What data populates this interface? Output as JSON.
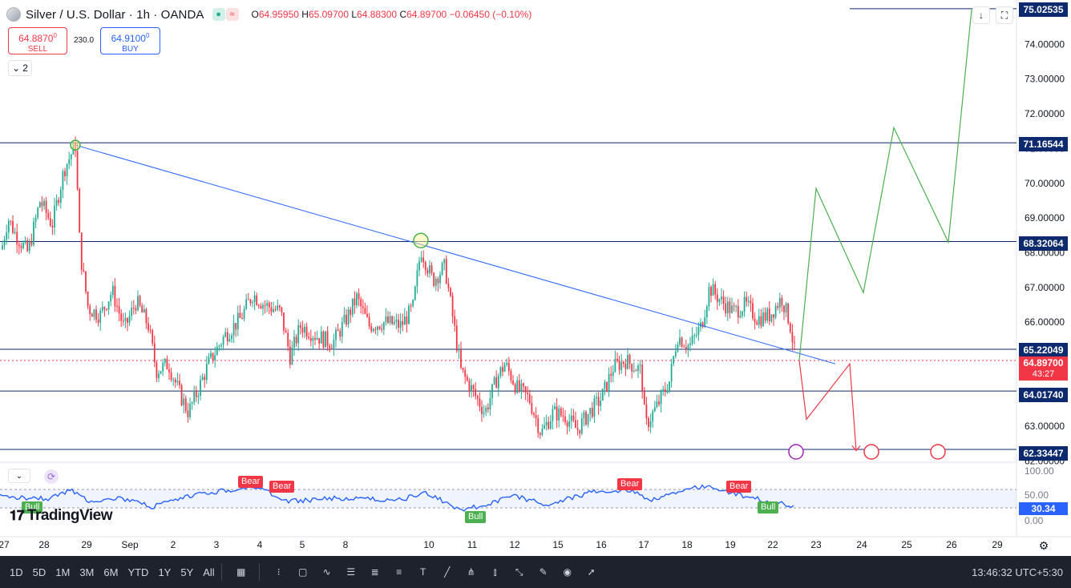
{
  "header": {
    "symbol_title": "Silver / U.S. Dollar · 1h · OANDA",
    "ohlc": {
      "open_label": "O",
      "open": "64.95950",
      "high_label": "H",
      "high": "65.09700",
      "low_label": "L",
      "low": "64.88300",
      "close_label": "C",
      "close": "64.89700",
      "change": "−0.06450 (−0.10%)"
    }
  },
  "trade": {
    "sell_price": "64.8870",
    "sell_price_sup": "0",
    "sell_label": "SELL",
    "spread": "230.0",
    "buy_price": "64.9100",
    "buy_price_sup": "0",
    "buy_label": "BUY"
  },
  "indicators_toggle": {
    "count": "2"
  },
  "price_axis": {
    "ticks": [
      "75.00000",
      "74.00000",
      "73.00000",
      "72.00000",
      "71.00000",
      "70.00000",
      "69.00000",
      "68.00000",
      "67.00000",
      "66.00000",
      "65.00000",
      "64.00000",
      "63.00000",
      "62.00000"
    ],
    "tags": {
      "top": "75.02535",
      "r1": "71.16544",
      "r2": "68.32064",
      "r3": "65.22049",
      "current_price": "64.89700",
      "countdown": "43:27",
      "s1": "64.01740",
      "s2": "62.33447"
    }
  },
  "rsi": {
    "value": "30.34",
    "ticks": [
      "100.00",
      "50.00",
      "0.00"
    ],
    "labels": {
      "bear": "Bear",
      "bull": "Bull",
      "bull_partial": "Bull"
    }
  },
  "time_axis": {
    "ticks": [
      {
        "label": "27"
      },
      {
        "label": "28"
      },
      {
        "label": "29"
      },
      {
        "label": "Sep"
      },
      {
        "label": "2"
      },
      {
        "label": "3"
      },
      {
        "label": "4"
      },
      {
        "label": "5"
      },
      {
        "label": "8"
      },
      {
        "label": "10"
      },
      {
        "label": "11"
      },
      {
        "label": "12"
      },
      {
        "label": "15"
      },
      {
        "label": "16"
      },
      {
        "label": "17"
      },
      {
        "label": "18"
      },
      {
        "label": "19"
      },
      {
        "label": "22"
      },
      {
        "label": "23"
      },
      {
        "label": "24"
      },
      {
        "label": "25"
      },
      {
        "label": "26"
      },
      {
        "label": "29"
      }
    ]
  },
  "logo": {
    "text": "TradingView"
  },
  "bottom_bar": {
    "timeframes": [
      "1D",
      "5D",
      "1M",
      "3M",
      "6M",
      "YTD",
      "1Y",
      "5Y",
      "All"
    ],
    "clock": "13:46:32 UTC+5:30"
  },
  "colors": {
    "up": "#22ab94",
    "down": "#f23645",
    "hline": "#0d2a6e",
    "trendline": "#2962ff",
    "projection_up": "#4caf50",
    "projection_down": "#f23645",
    "rsi_line": "#2962ff"
  }
}
